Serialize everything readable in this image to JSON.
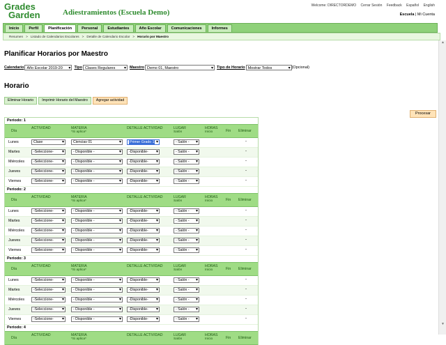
{
  "app": {
    "logo_line1": "Grades",
    "logo_line2": "Garden",
    "title": "Adiestramientos (Escuela Demo)"
  },
  "toplinks": [
    "Welcome: DIRECTORDEMO",
    "Cerrar Sesión",
    "Feedback",
    "Español",
    "English"
  ],
  "school": {
    "name": "Escuela",
    "sep": " | ",
    "account": "Mi Cuenta"
  },
  "nav": [
    {
      "label": "Inicio",
      "active": false
    },
    {
      "label": "Perfil",
      "active": false
    },
    {
      "label": "Planificación",
      "active": true
    },
    {
      "label": "Personal",
      "active": false
    },
    {
      "label": "Estudiantes",
      "active": false
    },
    {
      "label": "Año Escolar",
      "active": false
    },
    {
      "label": "Comunicaciones",
      "active": false
    },
    {
      "label": "Informes",
      "active": false
    }
  ],
  "breadcrumb": [
    "Resumen",
    "Listado de Calendarios Escolares",
    "Detalle de Calendario Escolar",
    "Horario por Maestro"
  ],
  "page_title": "Planificar Horarios por Maestro",
  "filters": {
    "calendario_label": "Calendario",
    "calendario_value": "Año Escolar 2019-20",
    "tipo_label": "Tipo",
    "tipo_value": "Clases Regulares",
    "maestro_label": "Maestro",
    "maestro_value": "Demo 01, Maestro",
    "tipo_horario_label": "Tipo de Horario",
    "tipo_horario_value": "Mostrar Todos",
    "opcional": "(Opcional)"
  },
  "section_title": "Horario",
  "actions": {
    "eliminar": "Eliminar Horario",
    "imprimir": "Imprimir Horario del Maestro",
    "agregar": "Agregar actividad",
    "procesar": "Procesar"
  },
  "columns": {
    "dia": "Día",
    "actividad": "ACTIVIDAD",
    "materia": "MATERIA",
    "materia_sub": "*Si aplica*",
    "detalle": "DETALLE ACTIVIDAD",
    "lugar": "LUGAR",
    "lugar_sub": "Salón",
    "horas": "HORAS",
    "inicio": "Inicio",
    "fin": "Fin",
    "eliminar": "Eliminar"
  },
  "periods": [
    {
      "label": "Periodo: 1",
      "rows": [
        {
          "day": "Lunes",
          "actividad": "Clase",
          "materia": "Ciencias 01",
          "detalle": "Primer Grado 1",
          "detalle_focused": true,
          "salon": "- Salón -",
          "eliminar": "-"
        },
        {
          "day": "Martes",
          "actividad": "-Seleccione-",
          "materia": "- Disponible -",
          "detalle": "-Disponible-",
          "salon": "- Salón -",
          "eliminar": "-"
        },
        {
          "day": "Miércoles",
          "actividad": "-Seleccione-",
          "materia": "- Disponible -",
          "detalle": "-Disponible-",
          "salon": "- Salón -",
          "eliminar": "-"
        },
        {
          "day": "Jueves",
          "actividad": "-Seleccione-",
          "materia": "- Disponible -",
          "detalle": "-Disponible-",
          "salon": "- Salón -",
          "eliminar": "-"
        },
        {
          "day": "Viernes",
          "actividad": "-Seleccione-",
          "materia": "- Disponible -",
          "detalle": "-Disponible-",
          "salon": "- Salón -",
          "eliminar": "-"
        }
      ]
    },
    {
      "label": "Periodo: 2",
      "rows": [
        {
          "day": "Lunes",
          "actividad": "-Seleccione-",
          "materia": "- Disponible -",
          "detalle": "-Disponible-",
          "salon": "- Salón -",
          "eliminar": "-"
        },
        {
          "day": "Martes",
          "actividad": "-Seleccione-",
          "materia": "- Disponible -",
          "detalle": "-Disponible-",
          "salon": "- Salón -",
          "eliminar": "-"
        },
        {
          "day": "Miércoles",
          "actividad": "-Seleccione-",
          "materia": "- Disponible -",
          "detalle": "-Disponible-",
          "salon": "- Salón -",
          "eliminar": "-"
        },
        {
          "day": "Jueves",
          "actividad": "-Seleccione-",
          "materia": "- Disponible -",
          "detalle": "-Disponible-",
          "salon": "- Salón -",
          "eliminar": "-"
        },
        {
          "day": "Viernes",
          "actividad": "-Seleccione-",
          "materia": "- Disponible -",
          "detalle": "-Disponible-",
          "salon": "- Salón -",
          "eliminar": "-"
        }
      ]
    },
    {
      "label": "Periodo: 3",
      "rows": [
        {
          "day": "Lunes",
          "actividad": "-Seleccione-",
          "materia": "- Disponible -",
          "detalle": "-Disponible-",
          "salon": "- Salón -",
          "eliminar": "-"
        },
        {
          "day": "Martes",
          "actividad": "-Seleccione-",
          "materia": "- Disponible -",
          "detalle": "-Disponible-",
          "salon": "- Salón -",
          "eliminar": "-"
        },
        {
          "day": "Miércoles",
          "actividad": "-Seleccione-",
          "materia": "- Disponible -",
          "detalle": "-Disponible-",
          "salon": "- Salón -",
          "eliminar": "-"
        },
        {
          "day": "Jueves",
          "actividad": "-Seleccione-",
          "materia": "- Disponible -",
          "detalle": "-Disponible-",
          "salon": "- Salón -",
          "eliminar": "-"
        },
        {
          "day": "Viernes",
          "actividad": "-Seleccione-",
          "materia": "- Disponible -",
          "detalle": "-Disponible-",
          "salon": "- Salón -",
          "eliminar": "-"
        }
      ]
    },
    {
      "label": "Periodo: 4",
      "rows": []
    }
  ],
  "colors": {
    "brand": "#2e8b2e",
    "nav": "#8fd17a",
    "header": "#9fdc85",
    "accent_button": "#ffe3b8"
  }
}
